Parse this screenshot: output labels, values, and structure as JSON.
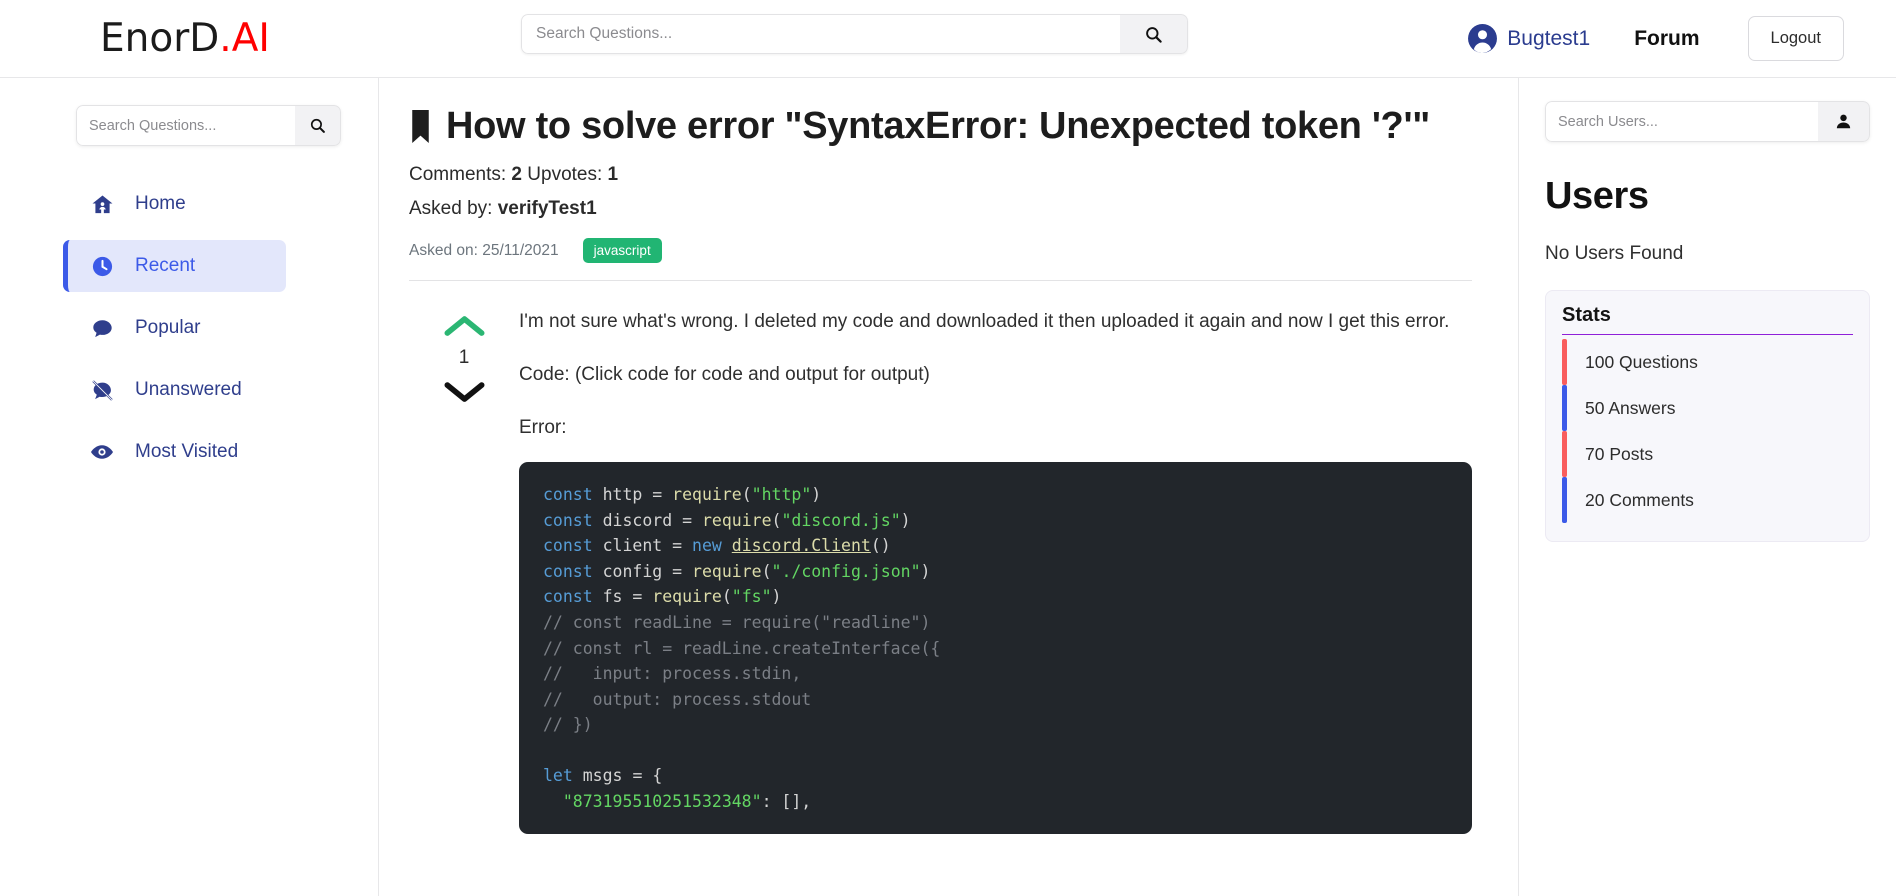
{
  "header": {
    "logo_dark": "EnorD",
    "logo_red": ".AI",
    "search_placeholder": "Search Questions...",
    "search_value": "",
    "search_icon": "search-icon",
    "username": "Bugtest1",
    "avatar_icon": "user-avatar-icon",
    "forum_label": "Forum",
    "logout_label": "Logout"
  },
  "sidebar": {
    "search_placeholder": "Search Questions...",
    "search_value": "",
    "items": [
      {
        "label": "Home",
        "icon": "home-icon",
        "active": false
      },
      {
        "label": "Recent",
        "icon": "clock-icon",
        "active": true
      },
      {
        "label": "Popular",
        "icon": "comment-icon",
        "active": false
      },
      {
        "label": "Unanswered",
        "icon": "comment-slash-icon",
        "active": false
      },
      {
        "label": "Most Visited",
        "icon": "eye-icon",
        "active": false
      }
    ]
  },
  "question": {
    "bookmark_icon": "bookmark-icon",
    "title": "How to solve error \"SyntaxError: Unexpected token '?'\"",
    "comments_label": "Comments:",
    "comments_count": "2",
    "upvotes_label": "Upvotes:",
    "upvotes_count": "1",
    "asked_by_label": "Asked by:",
    "asked_by": "verifyTest1",
    "asked_on": "Asked on: 25/11/2021",
    "tag": "javascript"
  },
  "answer": {
    "upvote_icon": "chevron-up-icon",
    "downvote_icon": "chevron-down-icon",
    "vote_count": "1",
    "paragraph_1": "I'm not sure what's wrong. I deleted my code and downloaded it then uploaded it again and now I get this error.",
    "paragraph_2": "Code: (Click code for code and output for output)",
    "paragraph_3": "Error:",
    "code_lines": [
      "const http = require(\"http\")",
      "const discord = require(\"discord.js\")",
      "const client = new discord.Client()",
      "const config = require(\"./config.json\")",
      "const fs = require(\"fs\")",
      "// const readLine = require(\"readline\")",
      "// const rl = readLine.createInterface({",
      "//   input: process.stdin,",
      "//   output: process.stdout",
      "// })",
      "",
      "let msgs = {",
      "  \"873195510251532348\": [],"
    ]
  },
  "rightbar": {
    "search_placeholder": "Search Users...",
    "search_value": "",
    "search_icon": "user-search-icon",
    "heading": "Users",
    "empty_text": "No Users Found",
    "stats_title": "Stats",
    "stats": [
      {
        "text": "100 Questions",
        "color": "#f95d5d"
      },
      {
        "text": "50 Answers",
        "color": "#3c5ae8"
      },
      {
        "text": "70 Posts",
        "color": "#f95d5d"
      },
      {
        "text": "20 Comments",
        "color": "#3c5ae8"
      }
    ]
  },
  "colors": {
    "brand_red": "#ff0000",
    "accent_indigo": "#3c5ae8",
    "nav_text": "#2f3e8c",
    "tag_green": "#21b573",
    "upvote_green": "#2bb673",
    "stats_underline": "#8f20d8",
    "code_bg": "#22262b"
  }
}
